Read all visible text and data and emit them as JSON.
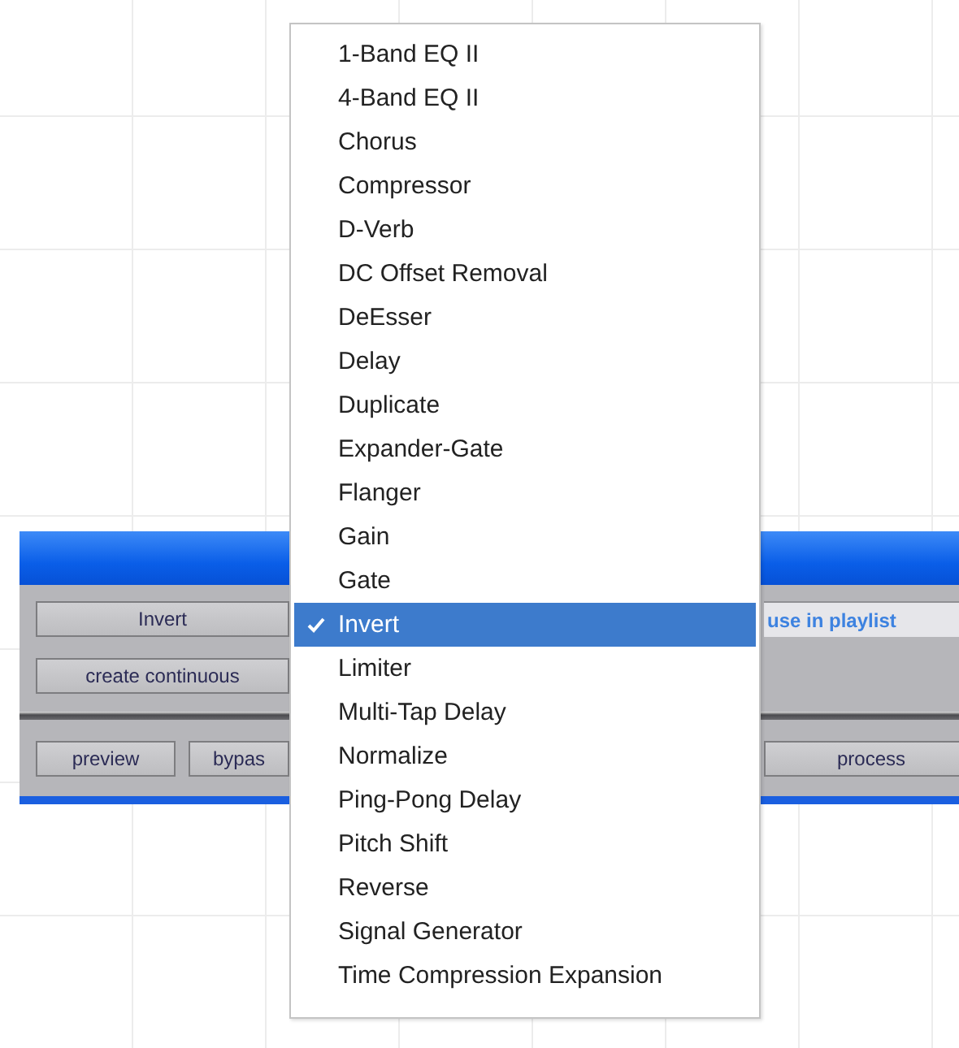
{
  "plugin_window": {
    "function_button": "Invert",
    "playlist_option": "use in playlist",
    "continuous_button": "create continuous",
    "preview_button": "preview",
    "bypass_button": "bypas",
    "process_button": "process"
  },
  "menu": {
    "items": [
      {
        "label": "1-Band EQ II",
        "selected": false
      },
      {
        "label": "4-Band EQ II",
        "selected": false
      },
      {
        "label": "Chorus",
        "selected": false
      },
      {
        "label": "Compressor",
        "selected": false
      },
      {
        "label": "D-Verb",
        "selected": false
      },
      {
        "label": "DC Offset Removal",
        "selected": false
      },
      {
        "label": "DeEsser",
        "selected": false
      },
      {
        "label": "Delay",
        "selected": false
      },
      {
        "label": "Duplicate",
        "selected": false
      },
      {
        "label": "Expander-Gate",
        "selected": false
      },
      {
        "label": "Flanger",
        "selected": false
      },
      {
        "label": "Gain",
        "selected": false
      },
      {
        "label": "Gate",
        "selected": false
      },
      {
        "label": "Invert",
        "selected": true
      },
      {
        "label": "Limiter",
        "selected": false
      },
      {
        "label": "Multi-Tap Delay",
        "selected": false
      },
      {
        "label": "Normalize",
        "selected": false
      },
      {
        "label": "Ping-Pong Delay",
        "selected": false
      },
      {
        "label": "Pitch Shift",
        "selected": false
      },
      {
        "label": "Reverse",
        "selected": false
      },
      {
        "label": "Signal Generator",
        "selected": false
      },
      {
        "label": "Time Compression Expansion",
        "selected": false
      }
    ]
  }
}
